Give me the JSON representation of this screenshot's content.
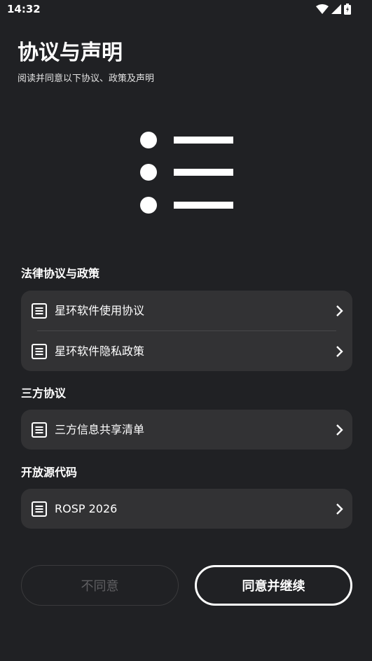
{
  "status_bar": {
    "time": "14:32"
  },
  "header": {
    "title": "协议与声明",
    "subtitle": "阅读并同意以下协议、政策及声明"
  },
  "sections": [
    {
      "title": "法律协议与政策",
      "items": [
        {
          "label": "星环软件使用协议",
          "icon": "document-icon"
        },
        {
          "label": "星环软件隐私政策",
          "icon": "document-icon"
        }
      ]
    },
    {
      "title": "三方协议",
      "items": [
        {
          "label": "三方信息共享清单",
          "icon": "document-icon"
        }
      ]
    },
    {
      "title": "开放源代码",
      "items": [
        {
          "label": "ROSP 2026",
          "icon": "document-icon"
        }
      ]
    }
  ],
  "buttons": {
    "disagree_label": "不同意",
    "agree_label": "同意并继续"
  },
  "colors": {
    "background": "#202124",
    "card": "#323234",
    "text": "#ffffff",
    "disabled_text": "#5f5f62"
  }
}
